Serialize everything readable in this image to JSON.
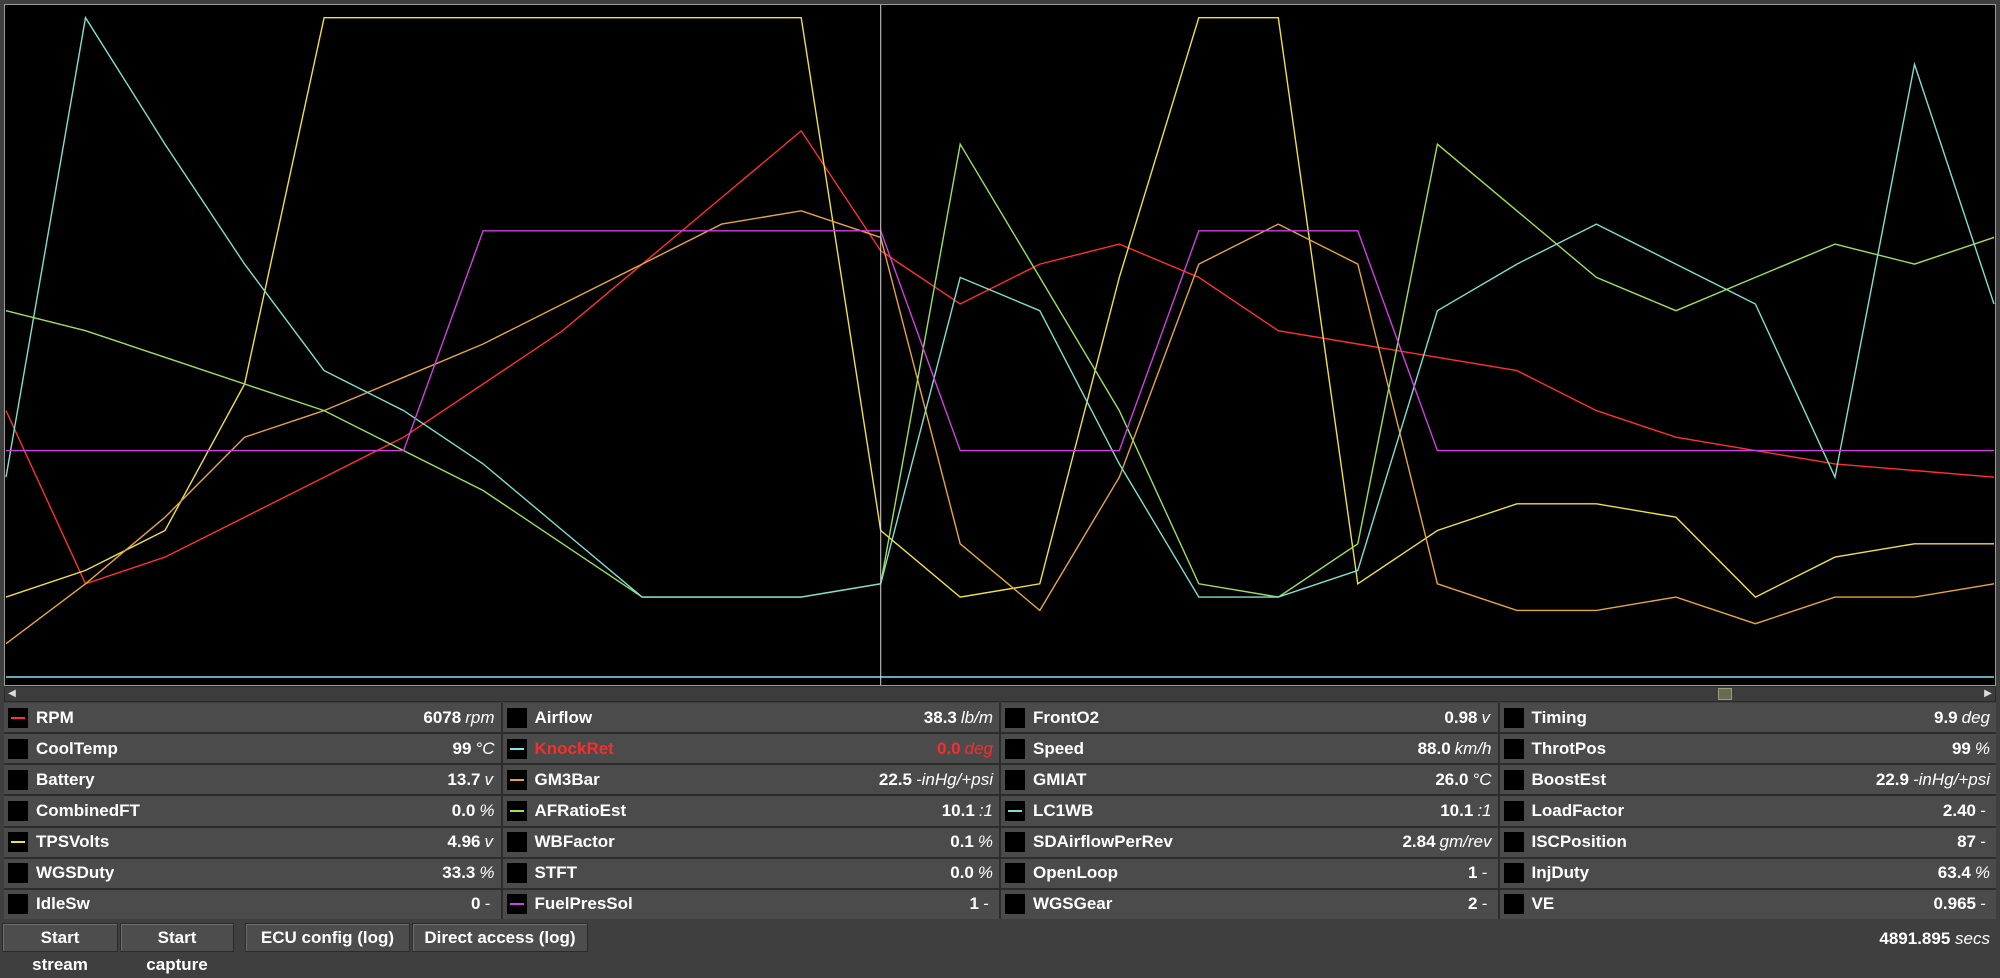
{
  "colors": {
    "rpm": "#ff3030",
    "knock": "#7ae8f0",
    "gm3bar": "#e6a63a",
    "afratio": "#9de05a",
    "lc1wb": "#7ee0d0",
    "tpsvolts": "#f0e040",
    "fuelpres": "#d040e0",
    "alert": "#ff2a2a"
  },
  "parameters": [
    {
      "name": "RPM",
      "value": "6078",
      "unit": "rpm",
      "color": "#ff3030"
    },
    {
      "name": "CoolTemp",
      "value": "99",
      "unit": "°C",
      "color": ""
    },
    {
      "name": "Battery",
      "value": "13.7",
      "unit": "v",
      "color": ""
    },
    {
      "name": "CombinedFT",
      "value": "0.0",
      "unit": "%",
      "color": ""
    },
    {
      "name": "TPSVolts",
      "value": "4.96",
      "unit": "v",
      "color": "#f0e040"
    },
    {
      "name": "WGSDuty",
      "value": "33.3",
      "unit": "%",
      "color": ""
    },
    {
      "name": "IdleSw",
      "value": "0",
      "unit": "-",
      "color": ""
    },
    {
      "name": "Airflow",
      "value": "38.3",
      "unit": "lb/m",
      "color": ""
    },
    {
      "name": "KnockRet",
      "value": "0.0",
      "unit": "deg",
      "color": "#7ae8f0",
      "alert": true
    },
    {
      "name": "GM3Bar",
      "value": "22.5",
      "unit": "-inHg/+psi",
      "color": "#e6a63a"
    },
    {
      "name": "AFRatioEst",
      "value": "10.1",
      "unit": ":1",
      "color": "#9de05a"
    },
    {
      "name": "WBFactor",
      "value": "0.1",
      "unit": "%",
      "color": ""
    },
    {
      "name": "STFT",
      "value": "0.0",
      "unit": "%",
      "color": ""
    },
    {
      "name": "FuelPresSol",
      "value": "1",
      "unit": "-",
      "color": "#d040e0"
    },
    {
      "name": "FrontO2",
      "value": "0.98",
      "unit": "v",
      "color": ""
    },
    {
      "name": "Speed",
      "value": "88.0",
      "unit": "km/h",
      "color": ""
    },
    {
      "name": "GMIAT",
      "value": "26.0",
      "unit": "°C",
      "color": ""
    },
    {
      "name": "LC1WB",
      "value": "10.1",
      "unit": ":1",
      "color": "#7ee0d0"
    },
    {
      "name": "SDAirflowPerRev",
      "value": "2.84",
      "unit": "gm/rev",
      "color": ""
    },
    {
      "name": "OpenLoop",
      "value": "1",
      "unit": "-",
      "color": ""
    },
    {
      "name": "WGSGear",
      "value": "2",
      "unit": "-",
      "color": ""
    },
    {
      "name": "Timing",
      "value": "9.9",
      "unit": "deg",
      "color": ""
    },
    {
      "name": "ThrotPos",
      "value": "99",
      "unit": "%",
      "color": ""
    },
    {
      "name": "BoostEst",
      "value": "22.9",
      "unit": "-inHg/+psi",
      "color": ""
    },
    {
      "name": "LoadFactor",
      "value": "2.40",
      "unit": "-",
      "color": ""
    },
    {
      "name": "ISCPosition",
      "value": "87",
      "unit": "-",
      "color": ""
    },
    {
      "name": "InjDuty",
      "value": "63.4",
      "unit": "%",
      "color": ""
    },
    {
      "name": "VE",
      "value": "0.965",
      "unit": "-",
      "color": ""
    }
  ],
  "toolbar": {
    "start_stream": "Start stream",
    "start_capture": "Start capture",
    "ecu_config": "ECU config (log)",
    "direct_access": "Direct access (log)"
  },
  "status": {
    "time_value": "4891.895",
    "time_unit": "secs"
  },
  "chart_data": {
    "type": "line",
    "title": "",
    "xlabel": "",
    "ylabel": "",
    "x": [
      0,
      4,
      8,
      12,
      16,
      20,
      24,
      28,
      32,
      36,
      40,
      44,
      48,
      52,
      56,
      60,
      64,
      68,
      72,
      76,
      80,
      84,
      88,
      92,
      96,
      100
    ],
    "cursor_x": 44,
    "series": [
      {
        "name": "RPM",
        "color": "#ff3030",
        "values": [
          40,
          14,
          18,
          24,
          30,
          36,
          44,
          52,
          62,
          72,
          82,
          64,
          56,
          62,
          65,
          60,
          52,
          50,
          48,
          46,
          40,
          36,
          34,
          32,
          31,
          30
        ]
      },
      {
        "name": "TPSVolts",
        "color": "#f0e040",
        "values": [
          12,
          16,
          22,
          44,
          99,
          99,
          99,
          99,
          99,
          99,
          99,
          22,
          12,
          14,
          60,
          99,
          99,
          14,
          22,
          26,
          26,
          24,
          12,
          18,
          20,
          20
        ]
      },
      {
        "name": "GM3Bar",
        "color": "#e6a63a",
        "values": [
          5,
          14,
          24,
          36,
          40,
          45,
          50,
          56,
          62,
          68,
          70,
          66,
          20,
          10,
          30,
          62,
          68,
          62,
          14,
          10,
          10,
          12,
          8,
          12,
          12,
          14
        ]
      },
      {
        "name": "AFRatioEst",
        "color": "#9de05a",
        "values": [
          55,
          52,
          48,
          44,
          40,
          34,
          28,
          20,
          12,
          12,
          12,
          14,
          80,
          60,
          40,
          14,
          12,
          20,
          80,
          70,
          60,
          55,
          60,
          65,
          62,
          66
        ]
      },
      {
        "name": "LC1WB",
        "color": "#7ee0d0",
        "values": [
          30,
          99,
          80,
          62,
          46,
          40,
          32,
          22,
          12,
          12,
          12,
          14,
          60,
          55,
          32,
          12,
          12,
          16,
          55,
          62,
          68,
          62,
          56,
          30,
          92,
          56
        ]
      },
      {
        "name": "FuelPresSol",
        "color": "#d040e0",
        "values": [
          34,
          34,
          34,
          34,
          34,
          34,
          67,
          67,
          67,
          67,
          67,
          67,
          34,
          34,
          34,
          67,
          67,
          67,
          34,
          34,
          34,
          34,
          34,
          34,
          34,
          34
        ]
      },
      {
        "name": "KnockRet",
        "color": "#7ae8f0",
        "values": [
          0,
          0,
          0,
          0,
          0,
          0,
          0,
          0,
          0,
          0,
          0,
          0,
          0,
          0,
          0,
          0,
          0,
          0,
          0,
          0,
          0,
          0,
          0,
          0,
          0,
          0
        ]
      }
    ],
    "ylim": [
      0,
      100
    ],
    "grid": false,
    "legend": "none"
  }
}
